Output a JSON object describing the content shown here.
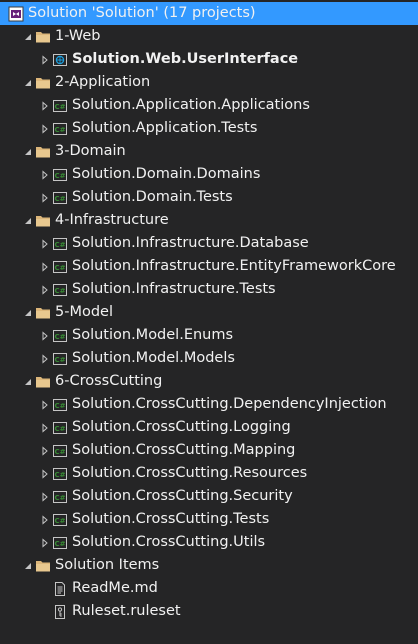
{
  "solution": {
    "label": "Solution 'Solution' (17 projects)",
    "icon": "visual-studio-solution-icon"
  },
  "folders": [
    {
      "label": "1-Web",
      "icon": "solution-folder-icon",
      "projects": [
        {
          "label": "Solution.Web.UserInterface",
          "icon": "web-project-icon",
          "bold": true
        }
      ]
    },
    {
      "label": "2-Application",
      "icon": "solution-folder-icon",
      "projects": [
        {
          "label": "Solution.Application.Applications",
          "icon": "csharp-project-icon"
        },
        {
          "label": "Solution.Application.Tests",
          "icon": "csharp-project-icon"
        }
      ]
    },
    {
      "label": "3-Domain",
      "icon": "solution-folder-icon",
      "projects": [
        {
          "label": "Solution.Domain.Domains",
          "icon": "csharp-project-icon"
        },
        {
          "label": "Solution.Domain.Tests",
          "icon": "csharp-project-icon"
        }
      ]
    },
    {
      "label": "4-Infrastructure",
      "icon": "solution-folder-icon",
      "projects": [
        {
          "label": "Solution.Infrastructure.Database",
          "icon": "csharp-project-icon"
        },
        {
          "label": "Solution.Infrastructure.EntityFrameworkCore",
          "icon": "csharp-project-icon"
        },
        {
          "label": "Solution.Infrastructure.Tests",
          "icon": "csharp-project-icon"
        }
      ]
    },
    {
      "label": "5-Model",
      "icon": "solution-folder-icon",
      "projects": [
        {
          "label": "Solution.Model.Enums",
          "icon": "csharp-project-icon"
        },
        {
          "label": "Solution.Model.Models",
          "icon": "csharp-project-icon"
        }
      ]
    },
    {
      "label": "6-CrossCutting",
      "icon": "solution-folder-icon",
      "projects": [
        {
          "label": "Solution.CrossCutting.DependencyInjection",
          "icon": "csharp-project-icon"
        },
        {
          "label": "Solution.CrossCutting.Logging",
          "icon": "csharp-project-icon"
        },
        {
          "label": "Solution.CrossCutting.Mapping",
          "icon": "csharp-project-icon"
        },
        {
          "label": "Solution.CrossCutting.Resources",
          "icon": "csharp-project-icon"
        },
        {
          "label": "Solution.CrossCutting.Security",
          "icon": "csharp-project-icon"
        },
        {
          "label": "Solution.CrossCutting.Tests",
          "icon": "csharp-project-icon"
        },
        {
          "label": "Solution.CrossCutting.Utils",
          "icon": "csharp-project-icon"
        }
      ]
    },
    {
      "label": "Solution Items",
      "icon": "solution-folder-icon",
      "files": [
        {
          "label": "ReadMe.md",
          "icon": "document-file-icon"
        },
        {
          "label": "Ruleset.ruleset",
          "icon": "ruleset-file-icon"
        }
      ]
    }
  ],
  "colors": {
    "background": "#252526",
    "selection": "#3399ff",
    "text": "#f1f1f1",
    "folder": "#dcb67a",
    "csharp_green": "#388a34",
    "web_blue": "#1ba1e2",
    "vs_purple": "#68217a"
  }
}
